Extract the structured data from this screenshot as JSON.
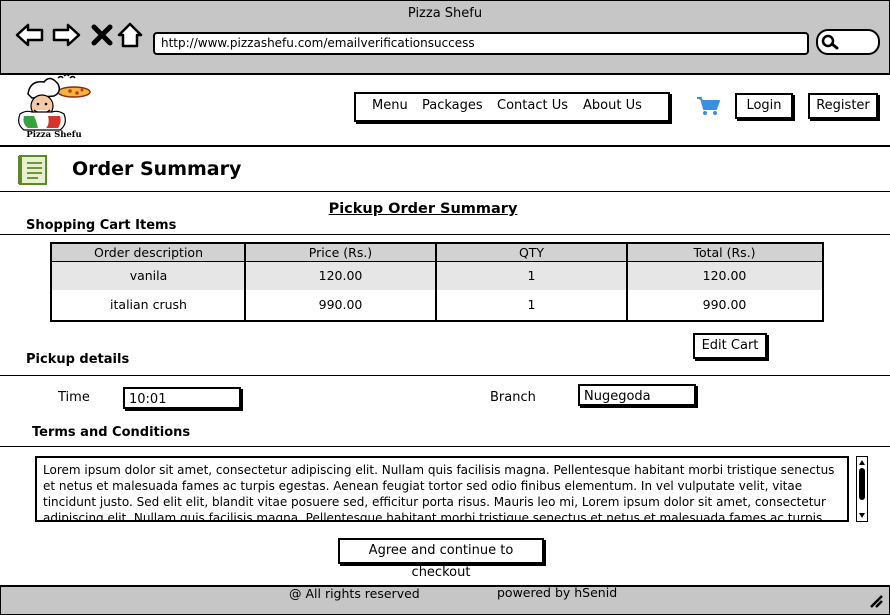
{
  "browser": {
    "title": "Pizza Shefu",
    "url": "http://www.pizzashefu.com/emailverificationsuccess"
  },
  "header": {
    "logo_text": "Pizza Shefu",
    "nav": [
      "Menu",
      "Packages",
      "Contact Us",
      "About Us"
    ],
    "login_label": "Login",
    "register_label": "Register",
    "cart_icon_color": "#3b8fe0"
  },
  "page": {
    "title": "Order Summary",
    "subtitle": "Pickup Order Summary"
  },
  "cart": {
    "section_label": "Shopping Cart Items",
    "headers": [
      "Order description",
      "Price (Rs.)",
      "QTY",
      "Total (Rs.)"
    ],
    "rows": [
      [
        "vanila",
        "120.00",
        "1",
        "120.00"
      ],
      [
        "italian crush",
        "990.00",
        "1",
        "990.00"
      ]
    ],
    "edit_label": "Edit Cart"
  },
  "pickup": {
    "section_label": "Pickup details",
    "time_label": "Time",
    "time_value": "10:01",
    "branch_label": "Branch",
    "branch_value": "Nugegoda"
  },
  "terms": {
    "section_label": "Terms and Conditions",
    "text": "Lorem ipsum dolor sit amet, consectetur adipiscing elit. Nullam quis facilisis magna. Pellentesque habitant morbi tristique senectus et netus et malesuada fames ac turpis egestas. Aenean feugiat tortor sed odio finibus elementum. In vel vulputate velit, vitae tincidunt justo. Sed elit elit, blandit vitae posuere sed, efficitur porta risus. Mauris leo mi, Lorem ipsum dolor sit amet, consectetur adipiscing elit. Nullam quis facilisis magna. Pellentesque habitant morbi tristique senectus et netus et malesuada fames ac turpis egestas. Aenean",
    "agree_label": "Agree and continue to checkout"
  },
  "footer": {
    "rights": "@ All rights reserved",
    "powered": "powered by hSenid"
  }
}
